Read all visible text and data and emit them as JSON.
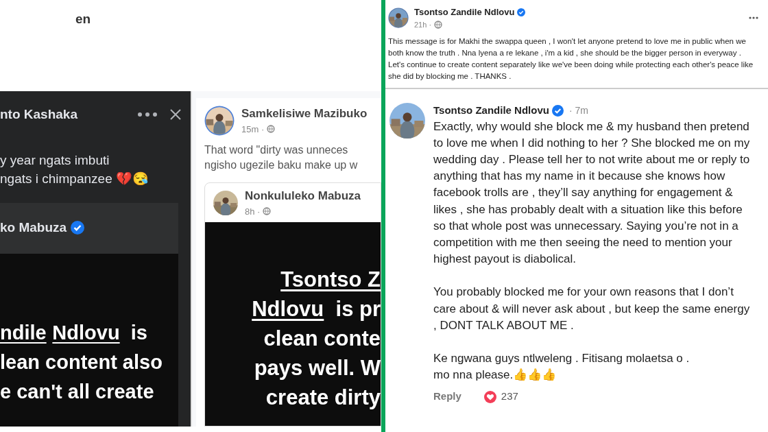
{
  "left_top": {
    "text": "en"
  },
  "dark_post": {
    "author": "nto Kashaka",
    "lines": [
      "y year ngats imbuti",
      "ngats i chimpanzee 💔😪"
    ],
    "shared": {
      "author": "ko Mabuza",
      "verified": true,
      "story_lines": [
        [
          {
            "text": "ndile",
            "underline": true
          },
          {
            "text": "Ndlovu",
            "underline": true
          },
          {
            "text": "  is"
          }
        ],
        [
          {
            "text": "lean content also"
          }
        ],
        [
          {
            "text": "e can't all create"
          }
        ]
      ]
    }
  },
  "light_post": {
    "author": "Samkelisiwe Mazibuko",
    "time": "15m ·",
    "lines": [
      "That word \"dirty was unneces",
      "ngisho ugezile baku make up w"
    ],
    "shared": {
      "author": "Nonkululeko Mabuza",
      "time": "8h ·",
      "story_lines": [
        [
          {
            "text": "Tsontso Z",
            "underline": true
          }
        ],
        [
          {
            "text": "Ndlovu",
            "underline": true
          },
          {
            "text": "  is pr"
          }
        ],
        [
          {
            "text": "clean conte"
          }
        ],
        [
          {
            "text": "pays well. W"
          }
        ],
        [
          {
            "text": "create dirty"
          }
        ]
      ]
    }
  },
  "post": {
    "author": "Tsontso Zandile Ndlovu",
    "verified": true,
    "time": "21h ·",
    "text": "This message is for Makhi the swappa queen , I won't let anyone pretend to love me in public when we both know the truth . Nna lyena a re lekane , i'm a kid , she should be the bigger person in everyway . Let's continue to create content separately like we've been doing while protecting each other's peace like she did by blocking me . THANKS ."
  },
  "comment": {
    "author": "Tsontso Zandile Ndlovu",
    "verified": true,
    "time": "· 7m",
    "paragraphs": [
      "Exactly, why would she block me & my husband then pretend to love me when I did nothing to her ? She blocked me on my wedding day . Please tell her to not write about me or reply to anything that has my name in it because she knows how facebook trolls are , they’ll say anything for engagement & likes , she has probably dealt with a situation like this before so that whole post was unnecessary. Saying you’re not in a competition with me then seeing the need to mention your highest payout is diabolical.",
      "You probably blocked me for your own reasons that I don’t care about & will never ask about , but keep the same energy , DONT TALK ABOUT ME .",
      "Ke ngwana guys ntlweleng . Fitisang molaetsa o .",
      "mo nna please.👍👍👍"
    ],
    "reply": "Reply",
    "reactions": "237"
  }
}
